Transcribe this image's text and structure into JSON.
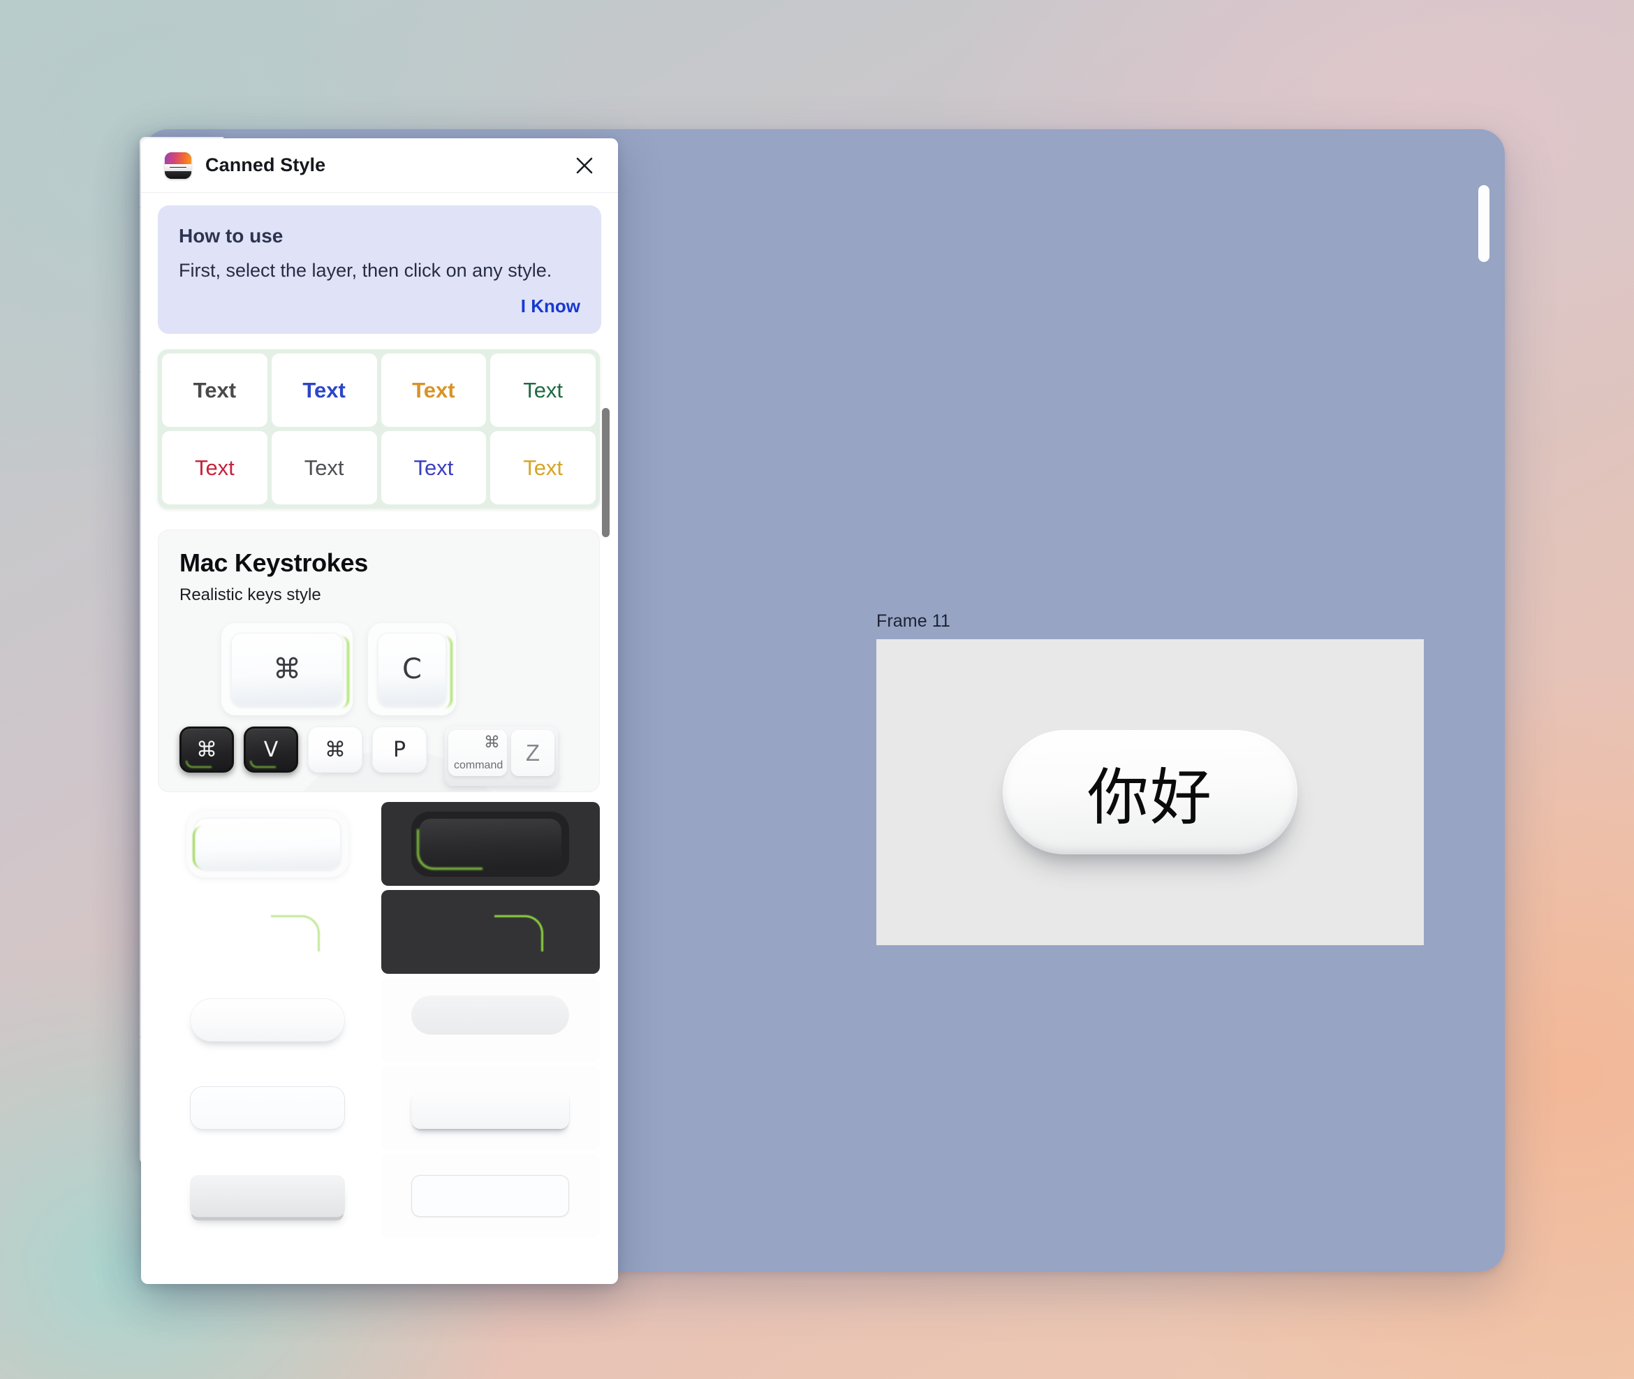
{
  "canvas": {
    "frame_label": "Frame 11",
    "button_text": "你好",
    "scrollbar_name": "canvas-scrollbar"
  },
  "back_panel": {
    "visible_label": "P"
  },
  "modal": {
    "title": "Canned Style",
    "icon_name": "canned-style-app-icon",
    "close_icon": "close-icon",
    "howto": {
      "title": "How to use",
      "text": "First, select the layer, then click on any style.",
      "action_label": "I Know"
    },
    "text_styles": {
      "label": "Text",
      "cells": [
        {
          "label": "Text",
          "color": "#4a4a4a",
          "weight": "bold"
        },
        {
          "label": "Text",
          "color": "#2b46c8",
          "weight": "bold"
        },
        {
          "label": "Text",
          "color": "#d79427",
          "weight": "bold"
        },
        {
          "label": "Text",
          "color": "#1f6b41",
          "weight": "normal"
        },
        {
          "label": "Text",
          "color": "#c7233c",
          "weight": "normal"
        },
        {
          "label": "Text",
          "color": "#4e5056",
          "weight": "normal"
        },
        {
          "label": "Text",
          "color": "#3b3fc0",
          "weight": "normal"
        },
        {
          "label": "Text",
          "color": "#d6a527",
          "weight": "normal"
        }
      ]
    },
    "keystrokes_card": {
      "title": "Mac Keystrokes",
      "subtitle": "Realistic keys style",
      "big_keys": [
        {
          "label": "⌘",
          "name": "big-command-key"
        },
        {
          "label": "C",
          "name": "big-c-key"
        }
      ],
      "small_keys": [
        {
          "label": "⌘",
          "variant": "dark",
          "name": "dark-command-key"
        },
        {
          "label": "V",
          "variant": "dark",
          "name": "dark-v-key"
        },
        {
          "label": "⌘",
          "variant": "light",
          "name": "light-command-key"
        },
        {
          "label": "P",
          "variant": "light",
          "name": "light-p-key"
        }
      ],
      "command_group": {
        "command_glyph": "⌘",
        "command_word": "command",
        "z_label": "Z"
      }
    },
    "swatches": [
      {
        "name": "swatch-light-inset-glow",
        "variant": "light-inset"
      },
      {
        "name": "swatch-dark-inset-glow",
        "variant": "dark-inset"
      },
      {
        "name": "swatch-light-corner-glow",
        "variant": "light-corner"
      },
      {
        "name": "swatch-dark-corner-glow",
        "variant": "dark-corner"
      },
      {
        "name": "swatch-soft-pill",
        "variant": "pill1"
      },
      {
        "name": "swatch-flat-gray-pill",
        "variant": "pill2"
      },
      {
        "name": "swatch-outlined-pill",
        "variant": "pill3"
      },
      {
        "name": "swatch-drop-shadow-pill",
        "variant": "pill4"
      },
      {
        "name": "swatch-hard-bevel-pill",
        "variant": "pill5"
      },
      {
        "name": "swatch-thin-border-pill",
        "variant": "pill6"
      }
    ],
    "scrollbar_name": "modal-scrollbar"
  },
  "colors": {
    "accent_green": "#8fd640",
    "link_blue": "#1839cf",
    "banner_bg": "#e0e2f7",
    "canvas_bg": "#97a4c4",
    "frame_bg": "#e8e8e8"
  }
}
